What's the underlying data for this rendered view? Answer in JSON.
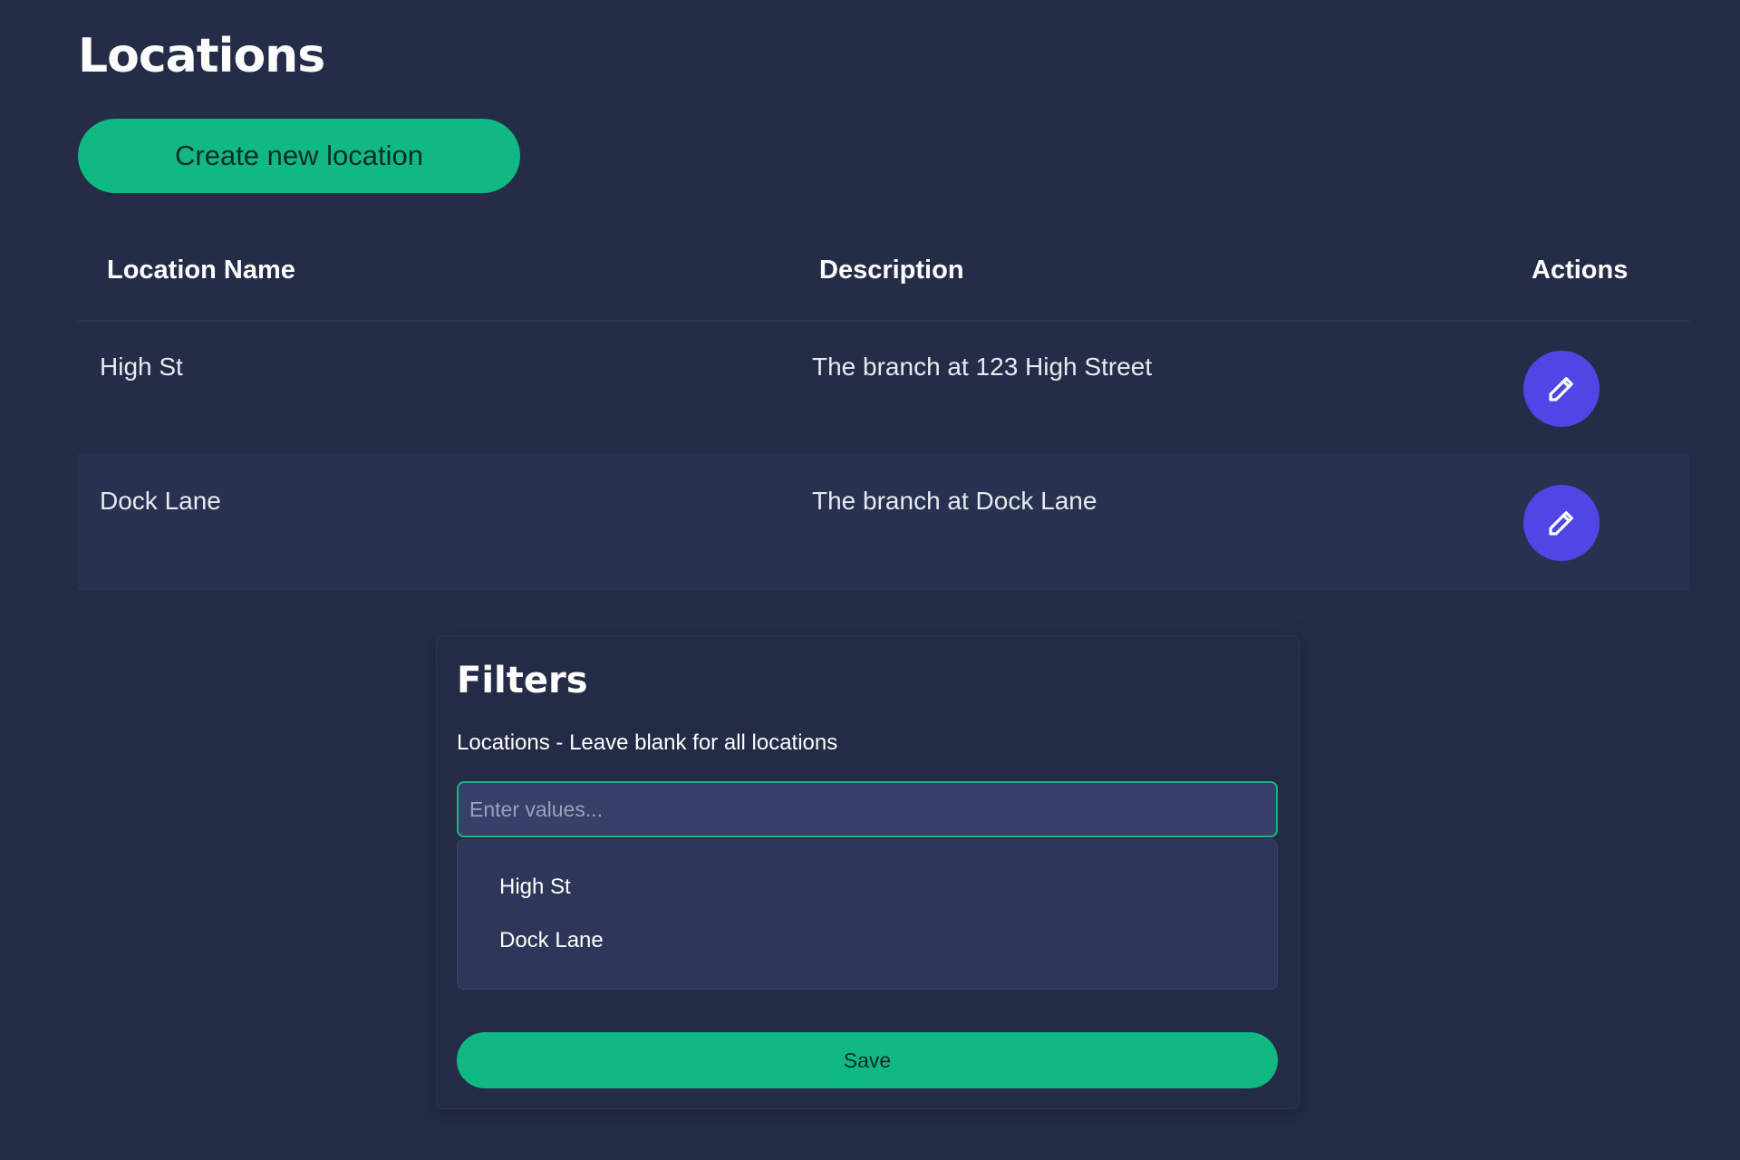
{
  "page": {
    "title": "Locations",
    "create_button_label": "Create new location"
  },
  "table": {
    "columns": {
      "name": "Location Name",
      "description": "Description",
      "actions": "Actions"
    },
    "rows": [
      {
        "name": "High St",
        "description": "The branch at 123 High Street",
        "action_icon": "pencil-icon"
      },
      {
        "name": "Dock Lane",
        "description": "The branch at Dock Lane",
        "action_icon": "pencil-icon"
      }
    ]
  },
  "filters": {
    "title": "Filters",
    "locations_label": "Locations - Leave blank for all locations",
    "input_placeholder": "Enter values...",
    "input_value": "",
    "options": [
      "High St",
      "Dock Lane"
    ],
    "save_label": "Save"
  },
  "colors": {
    "background": "#252c47",
    "accent_green": "#10b981",
    "action_purple": "#4f46e5"
  }
}
